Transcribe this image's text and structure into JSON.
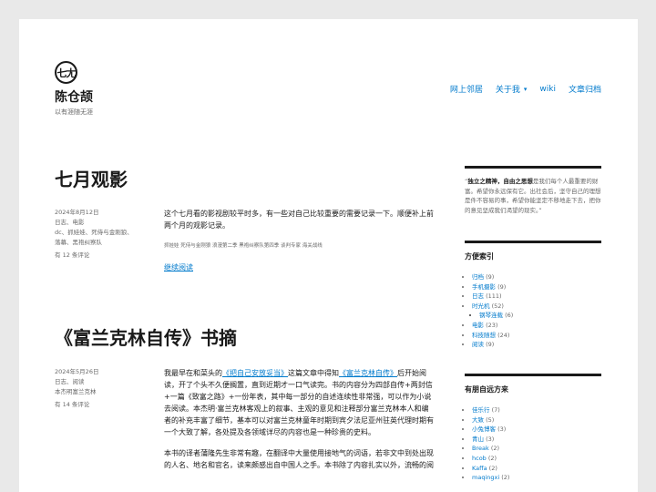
{
  "site": {
    "logo_text": "七尢",
    "title": "陈仓颉",
    "description": "以有涯随无涯"
  },
  "nav": {
    "items": [
      {
        "label": "网上邻居",
        "has_dropdown": false
      },
      {
        "label": "关于我",
        "has_dropdown": true
      },
      {
        "label": "wiki",
        "has_dropdown": false
      },
      {
        "label": "文章归档",
        "has_dropdown": false
      }
    ],
    "chevron": "▾"
  },
  "posts": [
    {
      "title": "七月观影",
      "date": "2024年8月12日",
      "categories": "日志、电影",
      "tags_meta_1": "dc、抓娃娃、死侍与金刚狼、",
      "tags_meta_2": "落幕、黑袍纠察队",
      "comments": "有 12 条评论",
      "paragraph": "这个七月看的影视剧较平时多，有一些对自己比较重要的需要记录一下。顺便补上前两个月的观影记录。",
      "tags_line": "抓娃娃  死侍与金刚狼  浪漫第二季  黑袍纠察队第四季  谈判专家  海关战线",
      "more": "继续阅读"
    },
    {
      "title": "《富兰克林自传》书摘",
      "date": "2024年5月26日",
      "categories": "日志、阅读",
      "tags_meta_1": "本杰明富兰克林",
      "comments": "有 14 条评论",
      "p1_before": "我最早在和菜头的",
      "p1_link1": "《把自己安放妥当》",
      "p1_mid": "这篇文章中得知",
      "p1_link2": "《富兰克林自传》",
      "p1_after": "后开始阅读，开了个头不久便搁置，直到近期才一口气读完。书的内容分为四部自传+两封信+一篇《致富之路》+一份年表，其中每一部分的自述连续性非常强，可以作为小说去阅读。本杰明·富兰克林客观上的叙事、主观的意见和注释部分富兰克林本人和编者的补充丰富了细节，基本可以对富兰克林童年时期到宾夕法尼亚州驻英代理时期有一个大致了解，各处提及各领域详尽的内容也是一种珍贵的史料。",
      "p2": "本书的译者蒲隆先生非常有趣，在翻译中大量使用接地气的词语，若非文中到处出现的人名、地名和官名，读来颇感出自中国人之手。本书除了内容扎实以外，流畅的阅"
    }
  ],
  "sidebar": {
    "quote_bold": "独立之精神，自由之思想",
    "quote_text": "是我们每个人最重要的财富。希望你永远保有它。出社会后，坚守自己的理想是件不容易的事，希望你能坚定不移地走下去，把你的意见坚成我们渴望的现实。",
    "categories_title": "方便索引",
    "categories": [
      {
        "name": "归档",
        "count": "(9)",
        "level": 0
      },
      {
        "name": "手机摄影",
        "count": "(9)",
        "level": 0
      },
      {
        "name": "日志",
        "count": "(111)",
        "level": 0
      },
      {
        "name": "时光机",
        "count": "(52)",
        "level": 0
      },
      {
        "name": "钢琴连载",
        "count": "(6)",
        "level": 1
      },
      {
        "name": "电影",
        "count": "(23)",
        "level": 0
      },
      {
        "name": "科技随想",
        "count": "(24)",
        "level": 0
      },
      {
        "name": "阅读",
        "count": "(9)",
        "level": 0
      }
    ],
    "friends_title": "有朋自远方来",
    "friends": [
      {
        "name": "佳乐行",
        "count": "(7)"
      },
      {
        "name": "大致",
        "count": "(5)"
      },
      {
        "name": "小兔博客",
        "count": "(3)"
      },
      {
        "name": "青山",
        "count": "(3)"
      },
      {
        "name": "Break",
        "count": "(2)"
      },
      {
        "name": "hcob",
        "count": "(2)"
      },
      {
        "name": "Kaffa",
        "count": "(2)"
      },
      {
        "name": "maqingxi",
        "count": "(2)"
      }
    ]
  },
  "colors": {
    "link": "#007acc",
    "text": "#1a1a1a",
    "muted": "#686868",
    "background": "#e9e9e9"
  }
}
